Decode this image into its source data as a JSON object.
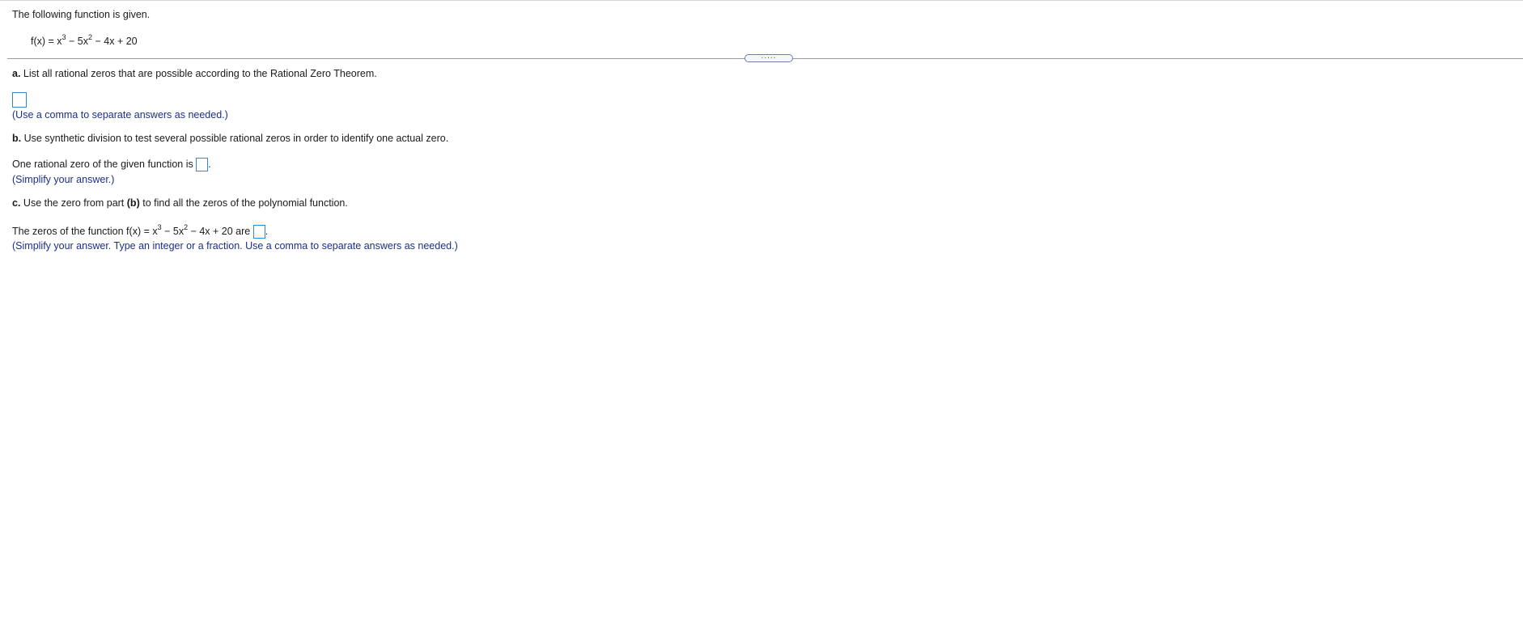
{
  "intro": "The following function is given.",
  "function": {
    "lhs": "f(x) = x",
    "exp3": "3",
    "mid": " − 5x",
    "exp2": "2",
    "rhs": " − 4x + 20"
  },
  "divider": {
    "dots": "....."
  },
  "part_a": {
    "letter": "a.",
    "prompt": "List all rational zeros that are possible according to the Rational Zero Theorem.",
    "hint": "(Use a comma to separate answers as needed.)"
  },
  "part_b": {
    "letter": "b.",
    "prompt": "Use synthetic division to test several possible rational zeros in order to identify one actual zero.",
    "answer_prefix": "One rational zero of the given function is",
    "answer_suffix": ".",
    "hint": "(Simplify your answer.)"
  },
  "part_c": {
    "letter": "c.",
    "prompt_before": "Use the zero from part",
    "prompt_ref": "(b)",
    "prompt_after": "to find all the zeros of the polynomial function.",
    "answer_prefix": "The zeros of the function f(x) = x",
    "exp3": "3",
    "mid": " − 5x",
    "exp2": "2",
    "rhs": " − 4x + 20 are",
    "answer_suffix": ".",
    "hint": "(Simplify your answer. Type an integer or a fraction. Use a comma to separate answers as needed.)"
  }
}
